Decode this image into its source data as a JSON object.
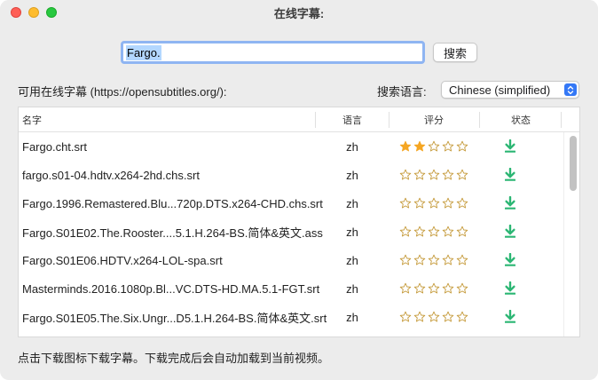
{
  "window": {
    "title": "在线字幕:"
  },
  "search": {
    "value": "Fargo.",
    "button_label": "搜索"
  },
  "available_label": "可用在线字幕 (https://opensubtitles.org/):",
  "language": {
    "label": "搜索语言:",
    "selected": "Chinese (simplified)"
  },
  "table": {
    "headers": {
      "name": "名字",
      "lang": "语言",
      "rating": "评分",
      "status": "状态"
    },
    "rows": [
      {
        "name": "Fargo.cht.srt",
        "lang": "zh",
        "rating": 2
      },
      {
        "name": "fargo.s01-04.hdtv.x264-2hd.chs.srt",
        "lang": "zh",
        "rating": 0
      },
      {
        "name": "Fargo.1996.Remastered.Blu...720p.DTS.x264-CHD.chs.srt",
        "lang": "zh",
        "rating": 0
      },
      {
        "name": "Fargo.S01E02.The.Rooster....5.1.H.264-BS.简体&英文.ass",
        "lang": "zh",
        "rating": 0
      },
      {
        "name": "Fargo.S01E06.HDTV.x264-LOL-spa.srt",
        "lang": "zh",
        "rating": 0
      },
      {
        "name": "Masterminds.2016.1080p.Bl...VC.DTS-HD.MA.5.1-FGT.srt",
        "lang": "zh",
        "rating": 0
      },
      {
        "name": "Fargo.S01E05.The.Six.Ungr...D5.1.H.264-BS.简体&英文.srt",
        "lang": "zh",
        "rating": 0
      }
    ],
    "max_rating": 5
  },
  "footer_text": "点击下载图标下载字幕。下载完成后会自动加载到当前视频。",
  "colors": {
    "star_filled": "#f5a623",
    "star_empty": "#c59a3a",
    "download": "#2bb673",
    "accent": "#3478f6"
  },
  "icons": {
    "download": "download-icon",
    "star": "star-icon"
  }
}
